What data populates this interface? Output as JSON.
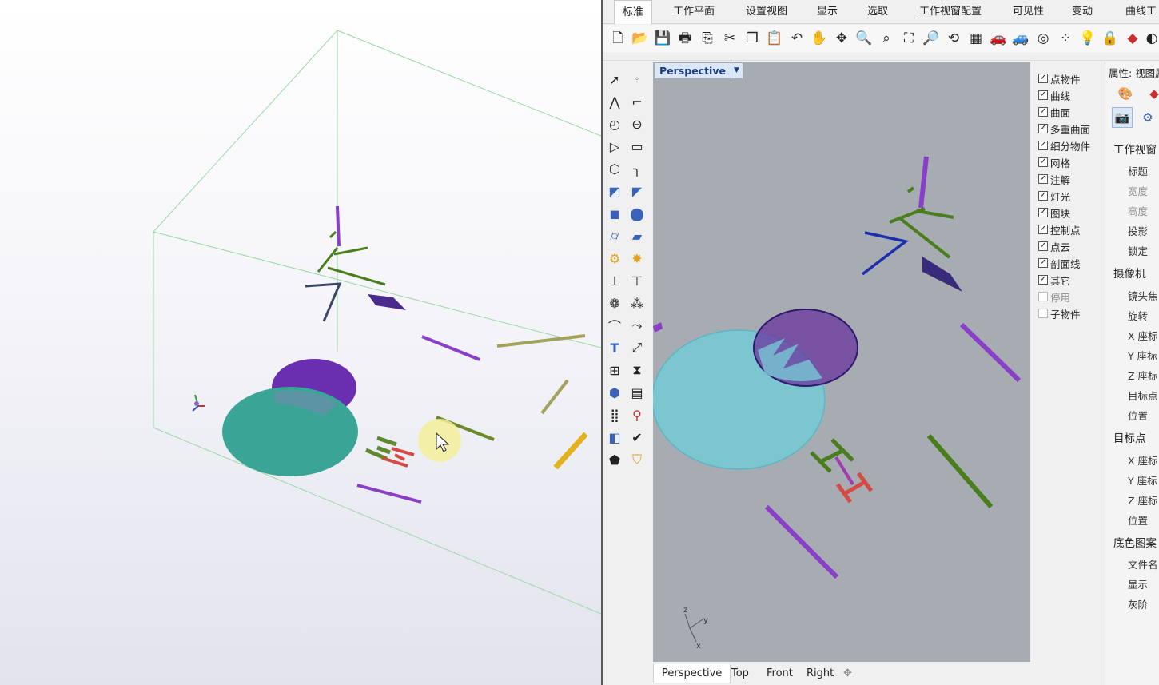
{
  "ribbon": {
    "tabs": [
      "标准",
      "工作平面",
      "设置视图",
      "显示",
      "选取",
      "工作视窗配置",
      "可见性",
      "变动",
      "曲线工"
    ],
    "active_tab": "标准"
  },
  "toolbar_icons": [
    "new-file-icon",
    "open-folder-icon",
    "save-icon",
    "print-icon",
    "import-icon",
    "cut-icon",
    "copy-icon",
    "paste-icon",
    "undo-icon",
    "pan-hand-icon",
    "move-view-icon",
    "zoom-icon",
    "zoom-window-icon",
    "zoom-extents-icon",
    "zoom-selected-icon",
    "rotate-view-icon",
    "four-viewports-icon",
    "car-render-icon",
    "shaded-car-icon",
    "snap-circle-icon",
    "grid-points-icon",
    "lightbulb-icon",
    "lock-icon",
    "layer-icon",
    "color-wheel-icon"
  ],
  "viewport": {
    "title": "Perspective",
    "axis": {
      "z": "z",
      "y": "y",
      "x": "x"
    }
  },
  "viewport_tabs": [
    "Perspective",
    "Top",
    "Front",
    "Right"
  ],
  "filter": {
    "items": [
      {
        "label": "点物件",
        "checked": true
      },
      {
        "label": "曲线",
        "checked": true
      },
      {
        "label": "曲面",
        "checked": true
      },
      {
        "label": "多重曲面",
        "checked": true
      },
      {
        "label": "细分物件",
        "checked": true
      },
      {
        "label": "网格",
        "checked": true
      },
      {
        "label": "注解",
        "checked": true
      },
      {
        "label": "灯光",
        "checked": true
      },
      {
        "label": "图块",
        "checked": true
      },
      {
        "label": "控制点",
        "checked": true
      },
      {
        "label": "点云",
        "checked": true
      },
      {
        "label": "剖面线",
        "checked": true
      },
      {
        "label": "其它",
        "checked": true
      },
      {
        "label": "停用",
        "checked": false
      },
      {
        "label": "子物件",
        "checked": false
      }
    ]
  },
  "properties": {
    "header": "属性: 视图属",
    "sections": {
      "viewport": "工作视窗",
      "viewport_rows": [
        "标题",
        "宽度",
        "高度",
        "投影",
        "锁定"
      ],
      "camera": "摄像机",
      "camera_rows": [
        "镜头焦",
        "旋转",
        "X 座标",
        "Y 座标",
        "Z 座标",
        "目标点",
        "位置"
      ],
      "target": "目标点",
      "target_rows": [
        "X 座标",
        "Y 座标",
        "Z 座标",
        "位置"
      ],
      "wallpaper": "底色图案",
      "wallpaper_rows": [
        "文件名",
        "显示",
        "灰阶"
      ]
    }
  },
  "colors": {
    "viewport_bg": "#a7acb3",
    "purple": "#8a3fc8",
    "green": "#4a7d1c",
    "cyan_disk": "#7cc6d0",
    "red": "#d64a45",
    "blue_line": "#1a2fb0"
  }
}
